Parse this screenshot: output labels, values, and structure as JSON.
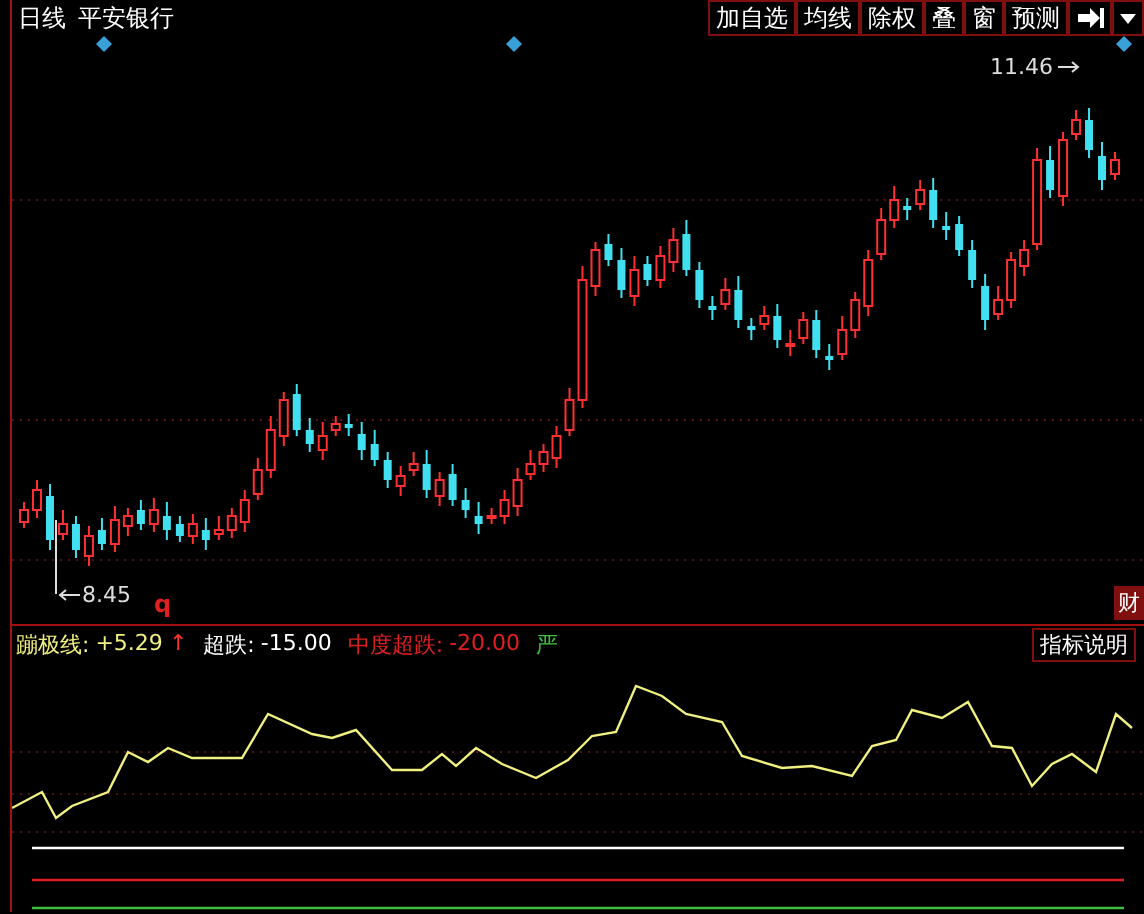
{
  "toolbar": {
    "period": "日线",
    "stock_name": "平安银行",
    "buttons": [
      "加自选",
      "均线",
      "除权",
      "叠",
      "窗",
      "预测"
    ]
  },
  "main_chart": {
    "high_label": "11.46",
    "low_label": "8.45",
    "marker": "q",
    "finance_button": "财"
  },
  "indicator": {
    "items": [
      {
        "kind": "line",
        "label": "蹦极线:",
        "value": "+5.29",
        "arrow": "↑",
        "color": "#f0f080"
      },
      {
        "kind": "level",
        "label": "超跌:",
        "value": "-15.00",
        "color": "#ffffff"
      },
      {
        "kind": "level",
        "label": "中度超跌:",
        "value": "-20.00",
        "color": "#e02020"
      },
      {
        "kind": "level",
        "label": "严",
        "color": "#40c040"
      }
    ],
    "help_button": "指标说明"
  }
}
